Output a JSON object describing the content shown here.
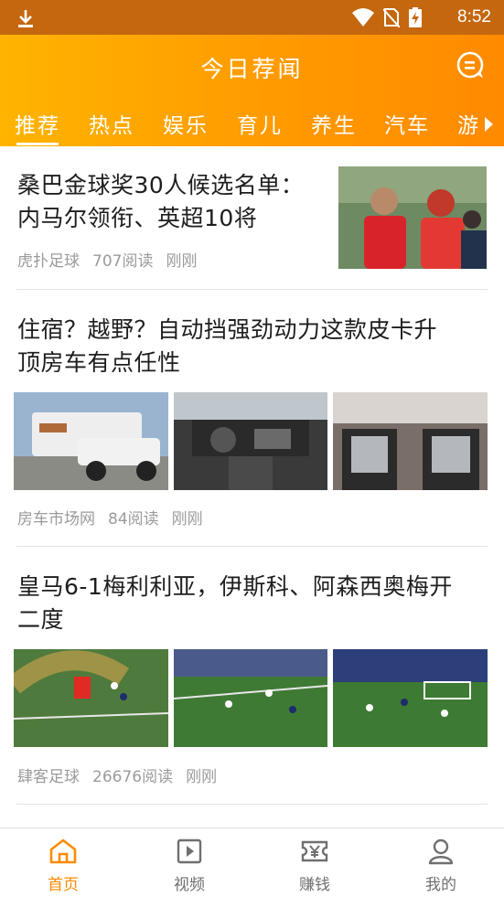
{
  "status_bar": {
    "time": "8:52",
    "icons": [
      "download-icon",
      "wifi-icon",
      "no-sim-icon",
      "battery-charging-icon"
    ]
  },
  "header": {
    "title": "今日荐闻",
    "right_icon": "message-icon",
    "background": "#ffa100"
  },
  "tabs": [
    {
      "label": "推荐",
      "active": true
    },
    {
      "label": "热点",
      "active": false
    },
    {
      "label": "娱乐",
      "active": false
    },
    {
      "label": "育儿",
      "active": false
    },
    {
      "label": "养生",
      "active": false
    },
    {
      "label": "汽车",
      "active": false
    },
    {
      "label": "游",
      "active": false
    }
  ],
  "articles": [
    {
      "title_line1": "桑巴金球奖30人候选名单：",
      "title_line2": "内马尔领衔、英超10将",
      "source": "虎扑足球",
      "reads": "707阅读",
      "time": "刚刚"
    },
    {
      "title_line1": "住宿？越野？自动挡强劲动力这款皮卡升",
      "title_line2": "顶房车有点任性",
      "source": "房车市场网",
      "reads": "84阅读",
      "time": "刚刚"
    },
    {
      "title_line1": "皇马6-1梅利利亚，伊斯科、阿森西奥梅开",
      "title_line2": "二度",
      "source": "肆客足球",
      "reads": "26676阅读",
      "time": "刚刚"
    }
  ],
  "bottom_nav": [
    {
      "label": "首页",
      "icon": "home-icon",
      "active": true
    },
    {
      "label": "视频",
      "icon": "video-icon",
      "active": false
    },
    {
      "label": "赚钱",
      "icon": "money-ticket-icon",
      "active": false
    },
    {
      "label": "我的",
      "icon": "profile-icon",
      "active": false
    }
  ],
  "colors": {
    "accent": "#ff8a00",
    "status_bar": "#c4670f",
    "meta_text": "#9b9b9b"
  }
}
